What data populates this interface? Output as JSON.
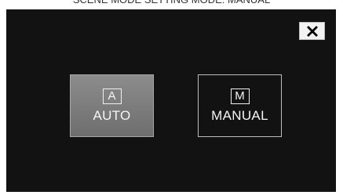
{
  "header": {
    "caption": "SCENE MODE SETTING MODE: MANUAL"
  },
  "dialog": {
    "close_icon": "close-icon",
    "modes": [
      {
        "icon_letter": "A",
        "label": "AUTO",
        "selected": true
      },
      {
        "icon_letter": "M",
        "label": "MANUAL",
        "selected": false
      }
    ]
  },
  "colors": {
    "screen_background": "#121212",
    "selected_button": "#7d7d7d",
    "text": "#f5f5f5"
  }
}
